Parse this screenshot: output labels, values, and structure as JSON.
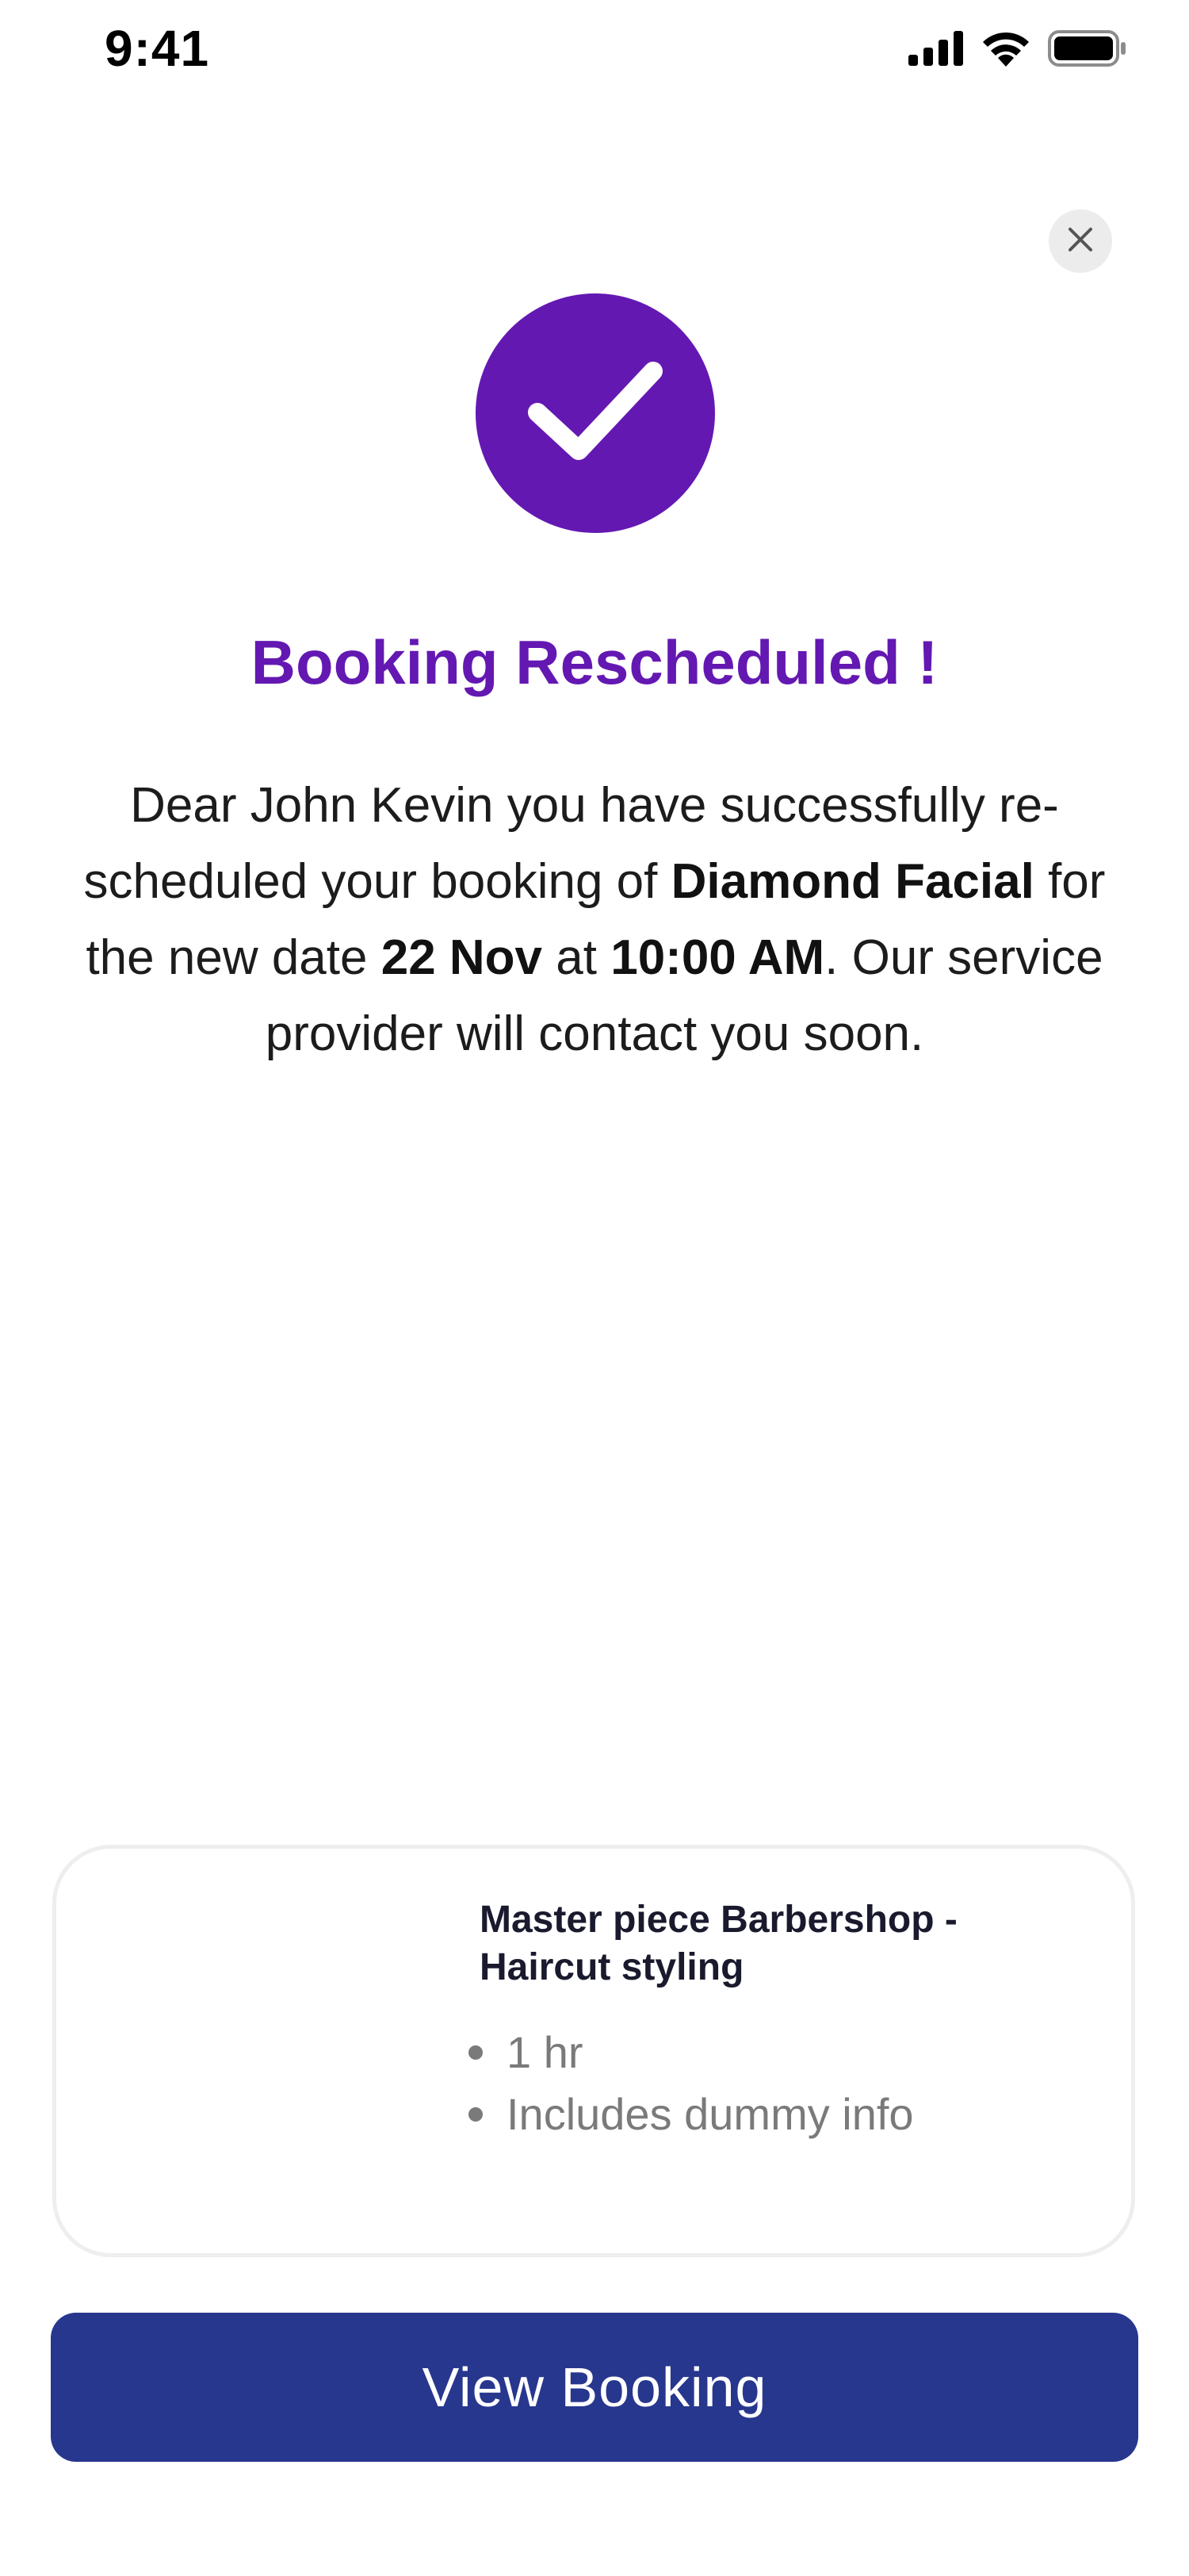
{
  "status_bar": {
    "time": "9:41"
  },
  "icons": {
    "close": "close-icon",
    "success": "checkmark-icon",
    "signal": "cellular-signal-icon",
    "wifi": "wifi-icon",
    "battery": "battery-icon"
  },
  "colors": {
    "accent": "#6418b2",
    "button": "#27378e",
    "close_bg": "#ececec"
  },
  "confirmation": {
    "title": "Booking Rescheduled !",
    "message_part1": "Dear John Kevin you have successfully re-scheduled your booking of ",
    "service_name": "Diamond Facial",
    "message_part2": " for the new date ",
    "date": "22 Nov",
    "message_part3": " at ",
    "time": "10:00 AM",
    "message_part4": ". Our service provider will contact you soon."
  },
  "service_card": {
    "title": "Master piece Barbershop - Haircut styling",
    "details": [
      "1 hr",
      "Includes dummy info"
    ]
  },
  "actions": {
    "view_booking_label": "View Booking"
  }
}
